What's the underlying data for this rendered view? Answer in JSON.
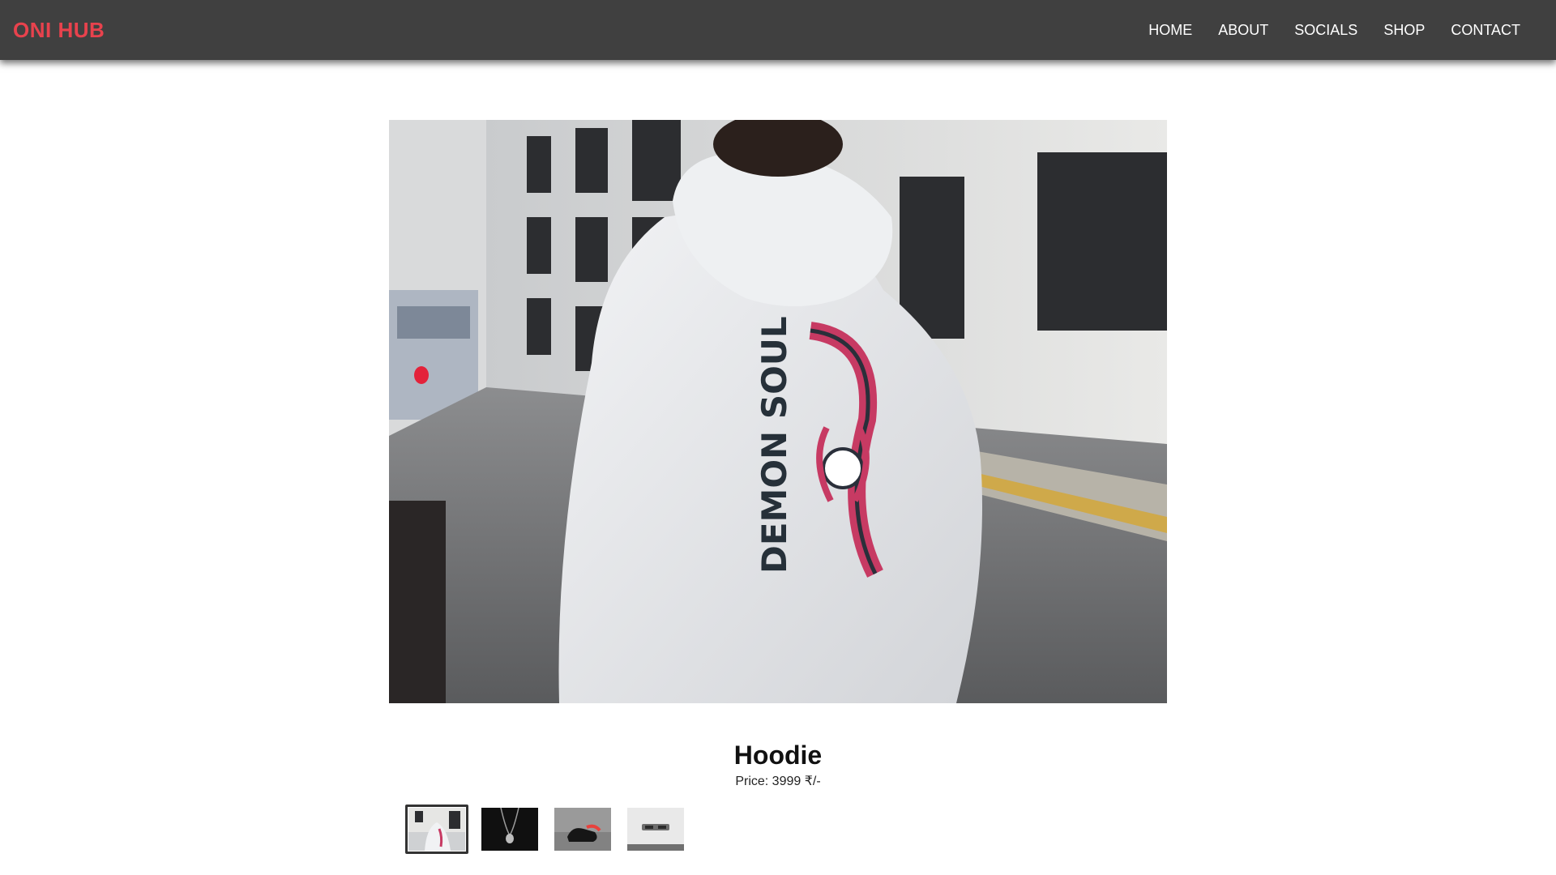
{
  "header": {
    "brand": "ONI HUB",
    "brand_color": "#e8424d",
    "nav": [
      {
        "label": "HOME"
      },
      {
        "label": "ABOUT"
      },
      {
        "label": "SOCIALS"
      },
      {
        "label": "SHOP"
      },
      {
        "label": "CONTACT"
      }
    ]
  },
  "product": {
    "image_description_icon": "hoodie-photo",
    "print_text": "DEMON SOUL",
    "title": "Hoodie",
    "price": "Price: 3999 ₹/-"
  },
  "thumbnails": [
    {
      "icon": "hoodie-thumbnail",
      "selected": true
    },
    {
      "icon": "chain-necklace-thumbnail",
      "selected": false
    },
    {
      "icon": "sneakers-thumbnail",
      "selected": false
    },
    {
      "icon": "sunglasses-thumbnail",
      "selected": false
    }
  ]
}
